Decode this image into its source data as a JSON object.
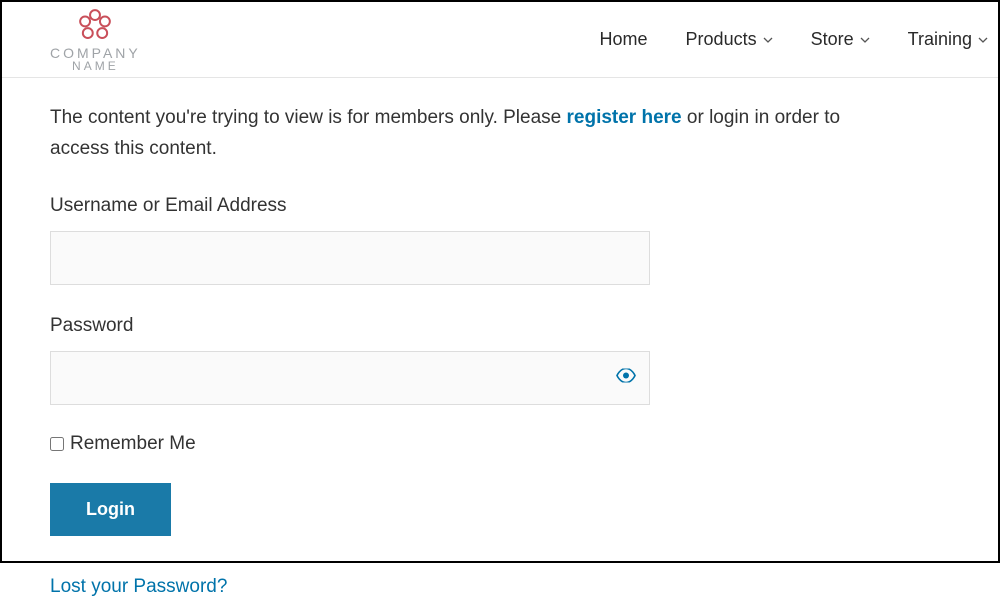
{
  "header": {
    "logo": {
      "line1": "COMPANY",
      "line2": "NAME"
    },
    "nav": [
      {
        "label": "Home",
        "hasDropdown": false
      },
      {
        "label": "Products",
        "hasDropdown": true
      },
      {
        "label": "Store",
        "hasDropdown": true
      },
      {
        "label": "Training",
        "hasDropdown": true
      }
    ]
  },
  "notice": {
    "before": "The content you're trying to view is for members only. Please ",
    "link": "register here",
    "after": " or login in order to access this content."
  },
  "form": {
    "username_label": "Username or Email Address",
    "password_label": "Password",
    "remember_label": "Remember Me",
    "login_label": "Login",
    "lost_password_label": "Lost your Password?"
  }
}
